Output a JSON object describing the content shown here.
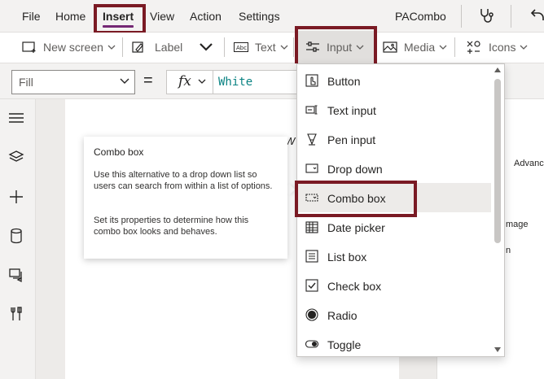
{
  "menubar": {
    "tabs": [
      {
        "label": "File"
      },
      {
        "label": "Home"
      },
      {
        "label": "Insert"
      },
      {
        "label": "View"
      },
      {
        "label": "Action"
      },
      {
        "label": "Settings"
      }
    ],
    "active_tab": "Insert",
    "app_name": "PACombo"
  },
  "ribbon": {
    "new_screen": "New screen",
    "label": "Label",
    "text": "Text",
    "input": "Input",
    "media": "Media",
    "icons": "Icons"
  },
  "formula_bar": {
    "property": "Fill",
    "equals": "=",
    "fx": "fx",
    "value": "White"
  },
  "tooltip": {
    "title": "Combo box",
    "para1": "Use this alternative to a drop down list so users can search from within a list of options.",
    "para2": "Set its properties to determine how this combo box looks and behaves."
  },
  "input_menu": {
    "items": [
      {
        "label": "Button",
        "icon": "button-icon"
      },
      {
        "label": "Text input",
        "icon": "text-input-icon"
      },
      {
        "label": "Pen input",
        "icon": "pen-icon"
      },
      {
        "label": "Drop down",
        "icon": "dropdown-icon"
      },
      {
        "label": "Combo box",
        "icon": "combo-box-icon"
      },
      {
        "label": "Date picker",
        "icon": "calendar-icon"
      },
      {
        "label": "List box",
        "icon": "list-box-icon"
      },
      {
        "label": "Check box",
        "icon": "checkbox-icon"
      },
      {
        "label": "Radio",
        "icon": "radio-icon"
      },
      {
        "label": "Toggle",
        "icon": "toggle-icon"
      }
    ],
    "highlighted": "Combo box"
  },
  "right_panel": {
    "advanced_fragment": "Advanc",
    "image_fragment": "mage",
    "n_fragment": "n"
  },
  "canvas_fragment": "W",
  "colors": {
    "accent": "#742774",
    "highlight_border": "#7a1a24",
    "formula_text": "#0b8383"
  }
}
